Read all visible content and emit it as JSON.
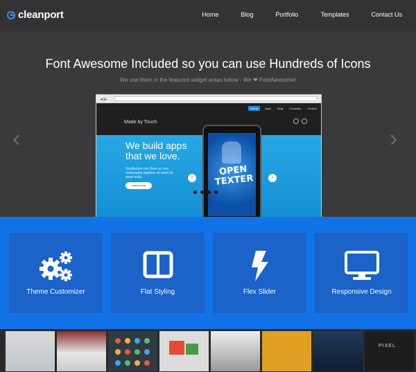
{
  "header": {
    "logo_text": "cleanport",
    "nav": [
      "Home",
      "Blog",
      "Portfolio",
      "Templates",
      "Contact Us"
    ]
  },
  "hero": {
    "title": "Font Awesome Included so you can use Hundreds of Icons",
    "subtitle_before": "We use them in the featured widget areas below - We",
    "subtitle_after": "FontAwesome!"
  },
  "mockup": {
    "site_nav": [
      "Home",
      "Apps",
      "Blog",
      "Company",
      "Contact"
    ],
    "made_by": "Made by Touch",
    "headline": "We build apps that we love.",
    "body": "Vestibulum nec diam ac nisi malesuada dapibus sit amet sit amet nulla.",
    "button": "Learn more",
    "phone_text": "OPEN TEXTER"
  },
  "features": [
    {
      "label": "Theme Customizer",
      "icon": "gears-icon"
    },
    {
      "label": "Flat Styling",
      "icon": "columns-icon"
    },
    {
      "label": "Flex Slider",
      "icon": "bolt-icon"
    },
    {
      "label": "Responsive Design",
      "icon": "desktop-icon"
    }
  ],
  "colors": {
    "accent": "#1273e6",
    "card": "#1b62c9",
    "header_bg": "#333335"
  },
  "thumbnails": {
    "pixel_label": "PIXEL"
  }
}
